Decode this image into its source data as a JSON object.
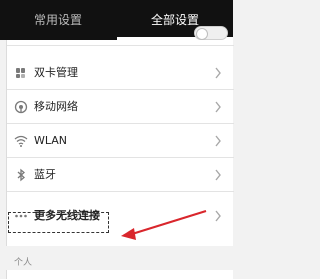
{
  "tabs": [
    {
      "label": "常用设置",
      "selected": false
    },
    {
      "label": "全部设置",
      "selected": true
    }
  ],
  "settings": {
    "items": [
      {
        "label": "双卡管理",
        "icon": "sim-card-icon"
      },
      {
        "label": "移动网络",
        "icon": "mobile-network-icon"
      },
      {
        "label": "WLAN",
        "icon": "wifi-icon"
      },
      {
        "label": "蓝牙",
        "icon": "bluetooth-icon"
      },
      {
        "label": "更多无线连接",
        "icon": "more-dots-icon"
      }
    ]
  },
  "section": {
    "personal_header": "个人"
  },
  "annotation": {
    "arrow_color": "#d9262c"
  },
  "colors": {
    "tabbar_bg": "#111111",
    "list_bg": "#ffffff",
    "page_bg": "#f2f2f2"
  }
}
